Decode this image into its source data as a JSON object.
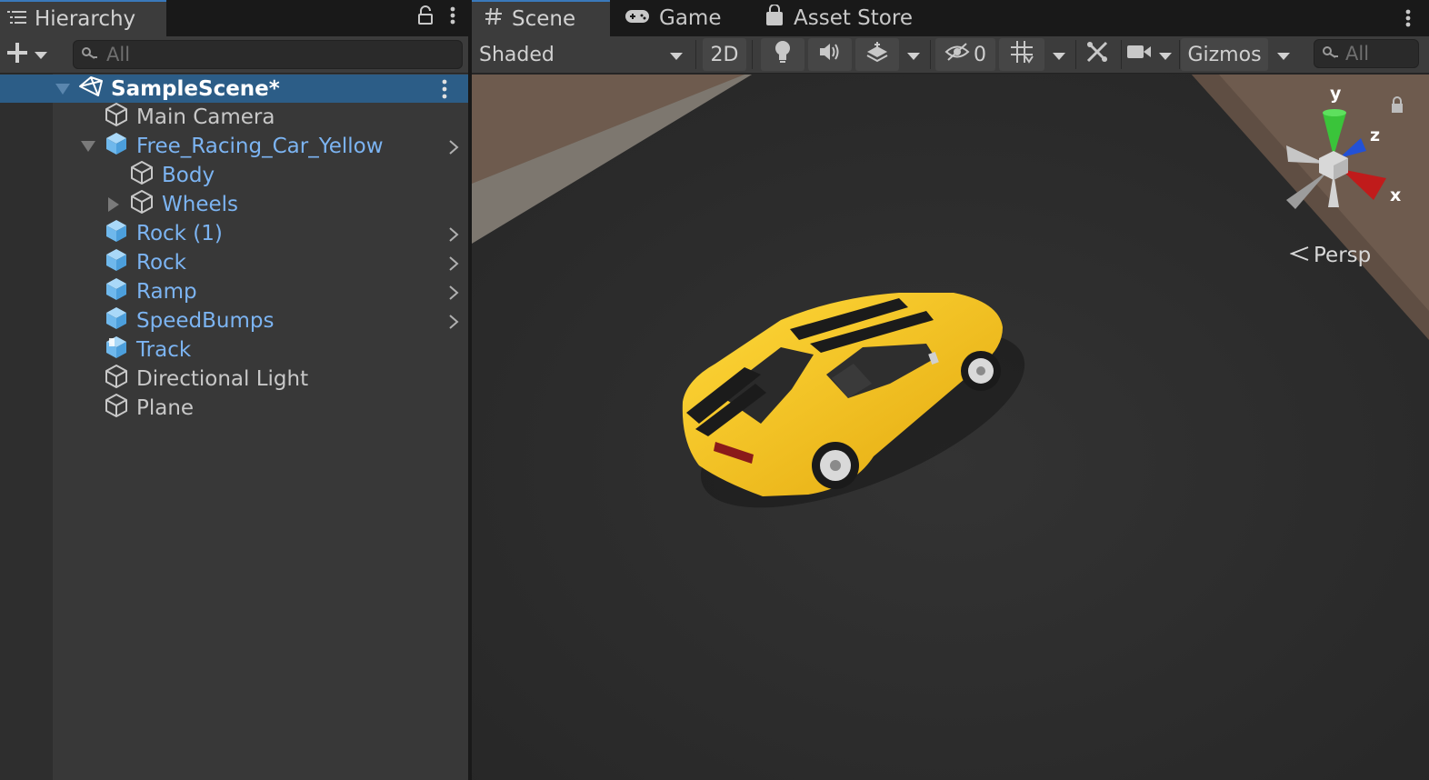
{
  "hierarchy": {
    "tab_label": "Hierarchy",
    "search_placeholder": "All",
    "scene_name": "SampleScene*",
    "items": [
      {
        "label": "Main Camera",
        "type": "gameobject"
      },
      {
        "label": "Free_Racing_Car_Yellow",
        "type": "prefab"
      },
      {
        "label": "Body",
        "type": "prefab-child"
      },
      {
        "label": "Wheels",
        "type": "prefab-child"
      },
      {
        "label": "Rock (1)",
        "type": "prefab"
      },
      {
        "label": "Rock",
        "type": "prefab"
      },
      {
        "label": "Ramp",
        "type": "prefab"
      },
      {
        "label": "SpeedBumps",
        "type": "prefab"
      },
      {
        "label": "Track",
        "type": "model-prefab"
      },
      {
        "label": "Directional Light",
        "type": "gameobject"
      },
      {
        "label": "Plane",
        "type": "gameobject"
      }
    ]
  },
  "scene_tabs": [
    {
      "label": "Scene",
      "icon": "hash-icon",
      "active": true
    },
    {
      "label": "Game",
      "icon": "gamepad-icon",
      "active": false
    },
    {
      "label": "Asset Store",
      "icon": "shopping-bag-icon",
      "active": false
    }
  ],
  "scene_toolbar": {
    "draw_mode": "Shaded",
    "mode_2d": "2D",
    "hidden_count": "0",
    "gizmos": "Gizmos",
    "search_placeholder": "All"
  },
  "viewport": {
    "projection": "Persp",
    "axes": {
      "x": "x",
      "y": "y",
      "z": "z"
    }
  },
  "colors": {
    "accent": "#3a79bb",
    "selection": "#2c5d87",
    "prefab_text": "#7cb4f2",
    "car_body": "#f5c518"
  }
}
